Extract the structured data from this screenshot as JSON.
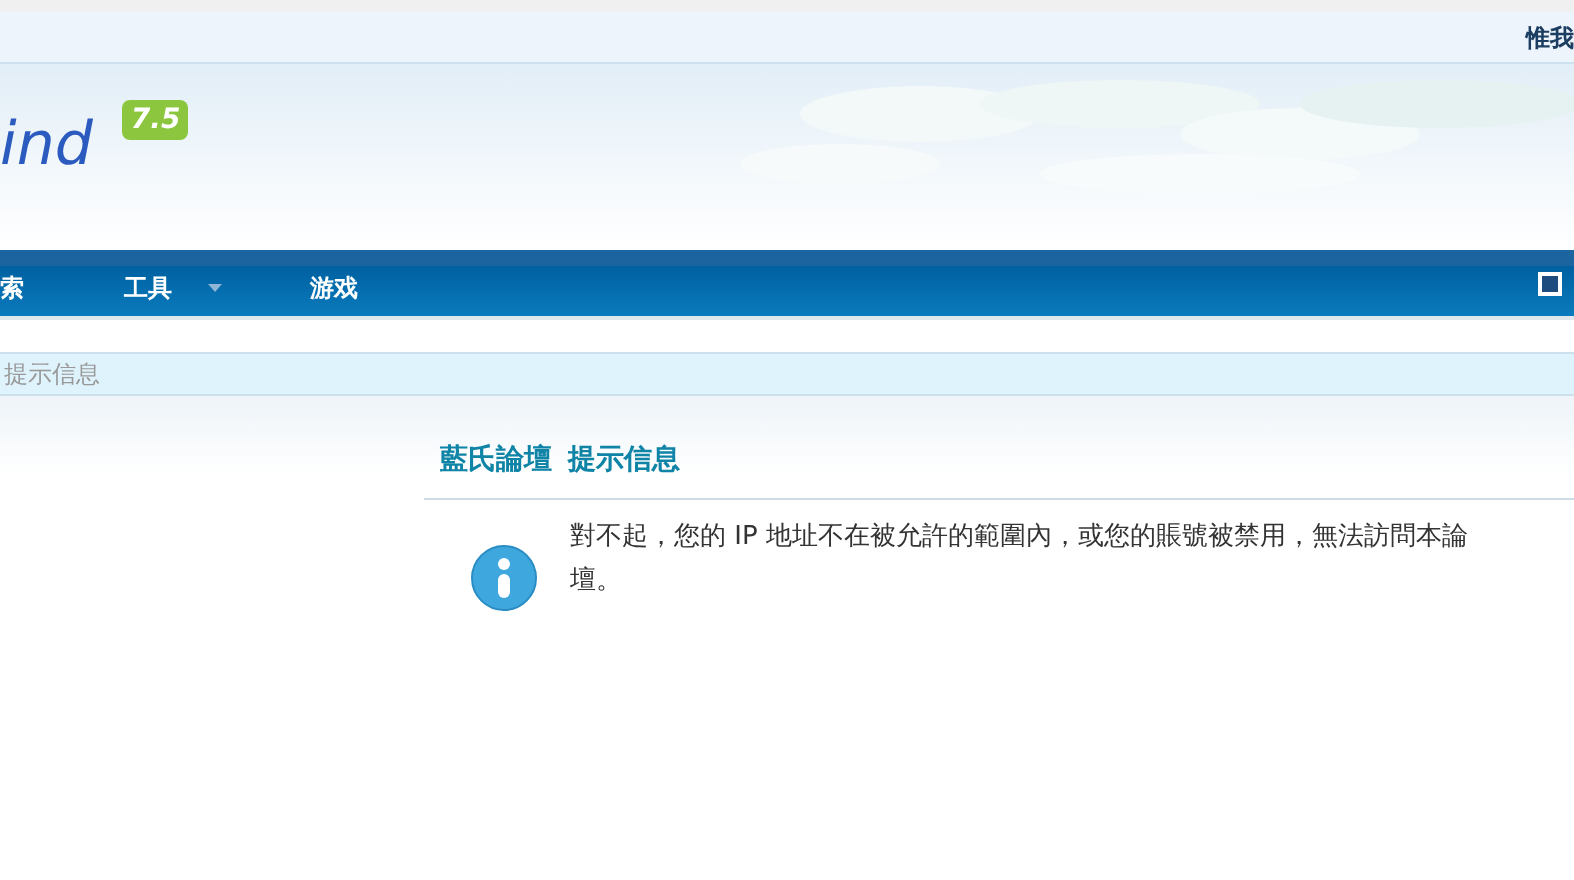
{
  "top_bar": {
    "right_text": "惟我"
  },
  "logo": {
    "text": "ind",
    "badge": "7.5"
  },
  "nav": {
    "items": [
      {
        "label": "索",
        "dropdown": false
      },
      {
        "label": "工具",
        "dropdown": true
      },
      {
        "label": "游戏",
        "dropdown": false
      }
    ]
  },
  "breadcrumb": "提示信息",
  "message": {
    "title_parts": [
      "藍氏論壇",
      "提示信息"
    ],
    "text": "對不起，您的 IP 地址不在被允許的範圍內，或您的賬號被禁用，無法訪問本論壇。"
  }
}
